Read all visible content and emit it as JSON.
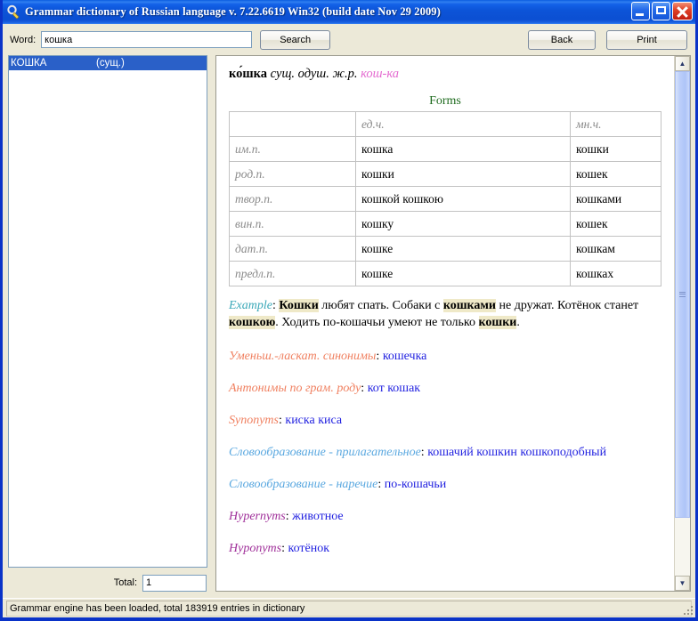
{
  "window": {
    "title": "Grammar dictionary of Russian language v. 7.22.6619  Win32  (build date Nov 29 2009)",
    "icon": "magnifier-key-icon",
    "minimize_label": "Minimize",
    "maximize_label": "Maximize",
    "close_label": "Close"
  },
  "toolbar": {
    "word_label": "Word:",
    "word_value": "кошка",
    "word_placeholder": "",
    "search_label": "Search",
    "back_label": "Back",
    "print_label": "Print"
  },
  "results": {
    "items": [
      {
        "word": "КОШКА",
        "pos": "(сущ.)",
        "selected": true
      }
    ],
    "total_label": "Total:",
    "total_value": "1"
  },
  "article": {
    "headword": "ко́шка",
    "grammar": "сущ. одуш. ж.р.",
    "syllabification": "кош-ка",
    "forms_title": "Forms",
    "forms_table": {
      "headers": [
        "",
        "ед.ч.",
        "мн.ч."
      ],
      "rows": [
        {
          "case": "им.п.",
          "sg": "кошка",
          "pl": "кошки"
        },
        {
          "case": "род.п.",
          "sg": "кошки",
          "pl": "кошек"
        },
        {
          "case": "твор.п.",
          "sg": "кошкой  кошкою",
          "pl": "кошками"
        },
        {
          "case": "вин.п.",
          "sg": "кошку",
          "pl": "кошек"
        },
        {
          "case": "дат.п.",
          "sg": "кошке",
          "pl": "кошкам"
        },
        {
          "case": "предл.п.",
          "sg": "кошке",
          "pl": "кошках"
        }
      ]
    },
    "example": {
      "label": "Example",
      "parts": [
        {
          "text": "Кошки",
          "highlight": true
        },
        {
          "text": " любят спать. Собаки с ",
          "highlight": false
        },
        {
          "text": "кошками",
          "highlight": true
        },
        {
          "text": " не дружат. Котёнок станет ",
          "highlight": false
        },
        {
          "text": "кошкою",
          "highlight": true
        },
        {
          "text": ". Ходить по-кошачьи умеют не только ",
          "highlight": false
        },
        {
          "text": "кошки",
          "highlight": true
        },
        {
          "text": ".",
          "highlight": false
        }
      ]
    },
    "entries": [
      {
        "label": "Уменьш.-ласкат. синонимы",
        "value": "кошечка",
        "style": "salmon"
      },
      {
        "label": "Антонимы по грам. роду",
        "value": "кот кошак",
        "style": "salmon"
      },
      {
        "label": "Synonyms",
        "value": "киска киса",
        "style": "salmon"
      },
      {
        "label": "Словообразование - прилагательное",
        "value": "кошачий кошкин кошкоподобный",
        "style": "cyan"
      },
      {
        "label": "Словообразование - наречие",
        "value": "по-кошачьи",
        "style": "cyan"
      },
      {
        "label": "Hypernyms",
        "value": "животное",
        "style": "purple"
      },
      {
        "label": "Hyponyms",
        "value": "котёнок",
        "style": "purple"
      }
    ]
  },
  "scrollbar": {
    "up_glyph": "▲",
    "down_glyph": "▼"
  },
  "statusbar": {
    "message": "Grammar engine has been loaded, total 183919 entries in dictionary"
  },
  "colors": {
    "titlebar_blue": "#0c54d8",
    "window_border": "#0a33c8",
    "selection_blue": "#2a60c8",
    "forms_green": "#1e6b1e",
    "label_salmon": "#f08060",
    "label_cyan": "#5aa8e0",
    "label_purple": "#a0309a",
    "value_blue": "#2222e0",
    "highlight_bg": "#efe9c8",
    "syllable_pink": "#e46ad0",
    "face": "#ece9d8"
  }
}
